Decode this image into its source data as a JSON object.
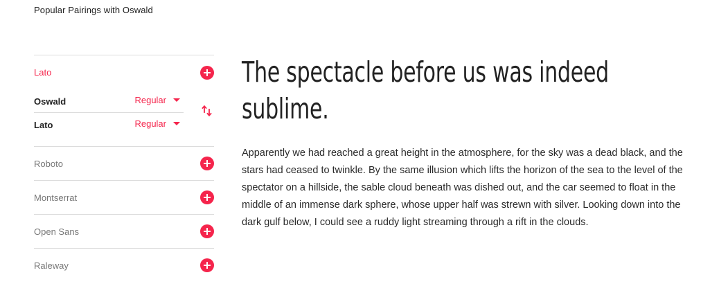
{
  "section_title": "Popular Pairings with Oswald",
  "active_pairing": {
    "label": "Lato",
    "heading_font": {
      "name": "Oswald",
      "weight": "Regular"
    },
    "body_font": {
      "name": "Lato",
      "weight": "Regular"
    }
  },
  "pairings": [
    {
      "label": "Roboto"
    },
    {
      "label": "Montserrat"
    },
    {
      "label": "Open Sans"
    },
    {
      "label": "Raleway"
    }
  ],
  "preview": {
    "headline": "The spectacle before us was indeed sublime.",
    "body": "Apparently we had reached a great height in the atmosphere, for the sky was a dead black, and the stars had ceased to twinkle. By the same illusion which lifts the horizon of the sea to the level of the spectator on a hillside, the sable cloud beneath was dished out, and the car seemed to float in the middle of an immense dark sphere, whose upper half was strewn with silver. Looking down into the dark gulf below, I could see a ruddy light streaming through a rift in the clouds."
  },
  "colors": {
    "accent": "#f5254c",
    "divider": "#dcdcdc",
    "text": "#222222",
    "muted": "#777777"
  },
  "icons": {
    "add": "plus-circle-icon",
    "swap": "swap-vertical-icon",
    "dropdown": "caret-down-icon"
  }
}
